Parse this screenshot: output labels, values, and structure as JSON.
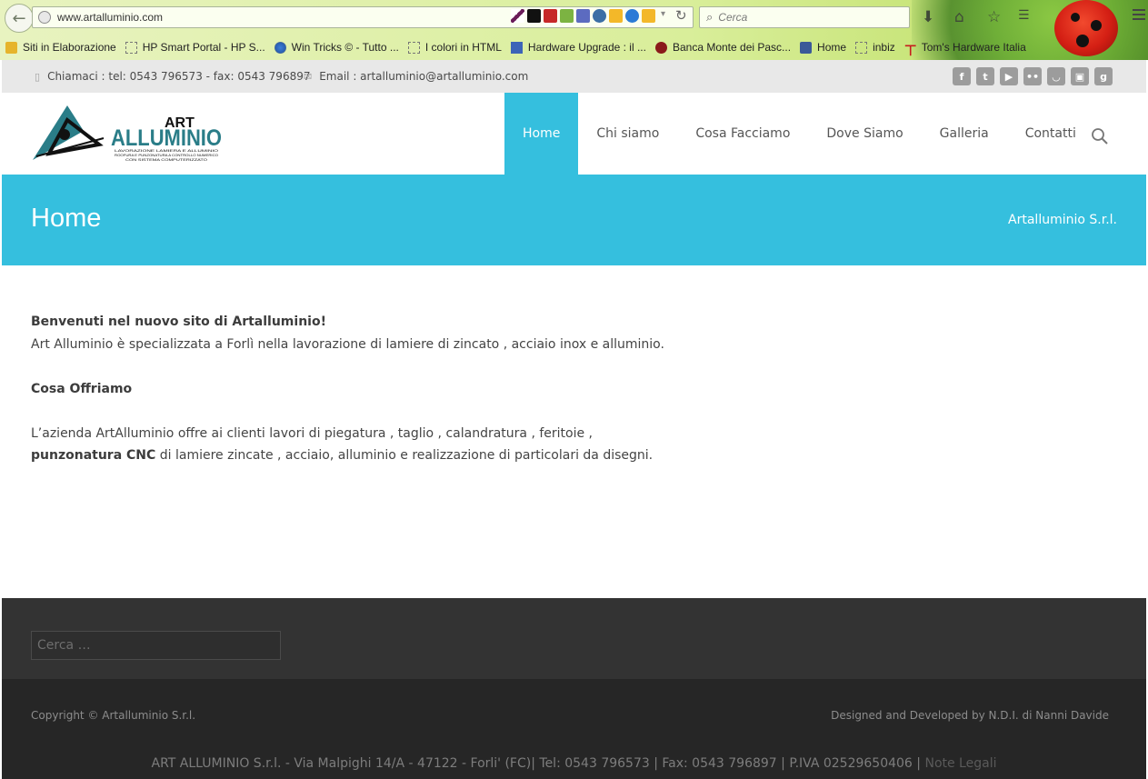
{
  "browser": {
    "url": "www.artalluminio.com",
    "search_placeholder": "Cerca",
    "bookmarks": [
      {
        "label": "Siti in Elaborazione",
        "icon": "folder-icon"
      },
      {
        "label": "HP Smart Portal - HP S...",
        "icon": "page-icon"
      },
      {
        "label": "Win Tricks © - Tutto ...",
        "icon": "globe-icon"
      },
      {
        "label": "I colori in HTML",
        "icon": "page-icon"
      },
      {
        "label": "Hardware Upgrade : il ...",
        "icon": "hwupgrade-icon"
      },
      {
        "label": "Banca Monte dei Pasc...",
        "icon": "bank-icon"
      },
      {
        "label": "Home",
        "icon": "facebook-icon"
      },
      {
        "label": "inbiz",
        "icon": "page-icon"
      },
      {
        "label": "Tom's Hardware Italia",
        "icon": "toms-hardware-icon"
      }
    ]
  },
  "topbar": {
    "phone": "Chiamaci : tel: 0543 796573 - fax: 0543 796897",
    "email": "Email : artalluminio@artalluminio.com",
    "social": [
      "facebook",
      "twitter",
      "youtube",
      "flickr",
      "rss",
      "instagram",
      "google-plus"
    ]
  },
  "logo": {
    "line1": "ART",
    "line2": "ALLUMINIO",
    "tagline1": "LAVORAZIONE LAMIERA E ALLUMINIO",
    "tagline2": "ROOFURA E PUNZONATURA A CONTROLLO NUMERICO",
    "tagline3": "CON SISTEMA COMPUTERIZZATO"
  },
  "nav": {
    "items": [
      "Home",
      "Chi siamo",
      "Cosa Facciamo",
      "Dove Siamo",
      "Galleria",
      "Contatti"
    ],
    "active": "Home"
  },
  "page": {
    "title": "Home",
    "breadcrumb": "Artalluminio S.r.l."
  },
  "content": {
    "welcome": "Benvenuti nel nuovo sito di Artalluminio!",
    "intro": "Art Alluminio è specializzata a Forlì nella lavorazione di lamiere di zincato , acciaio inox e alluminio.",
    "offer_heading": "Cosa Offriamo",
    "offer_text": "L’azienda ArtAlluminio offre ai clienti lavori di piegatura , taglio , calandratura , feritoie ,",
    "offer_bold": "punzonatura CNC",
    "offer_rest": " di lamiere zincate , acciaio, alluminio e realizzazione di particolari da disegni."
  },
  "footer": {
    "search_placeholder": "Cerca …",
    "copyright": "Copyright © Artalluminio S.r.l.",
    "credits": "Designed and Developed by N.D.I. di Nanni Davide",
    "address": "ART ALLUMINIO S.r.l. - Via Malpighi 14/A - 47122 - Forli' (FC)| Tel: 0543 796573 | Fax: 0543 796897 | P.IVA 02529650406 | ",
    "legal_link": "Note Legali"
  }
}
